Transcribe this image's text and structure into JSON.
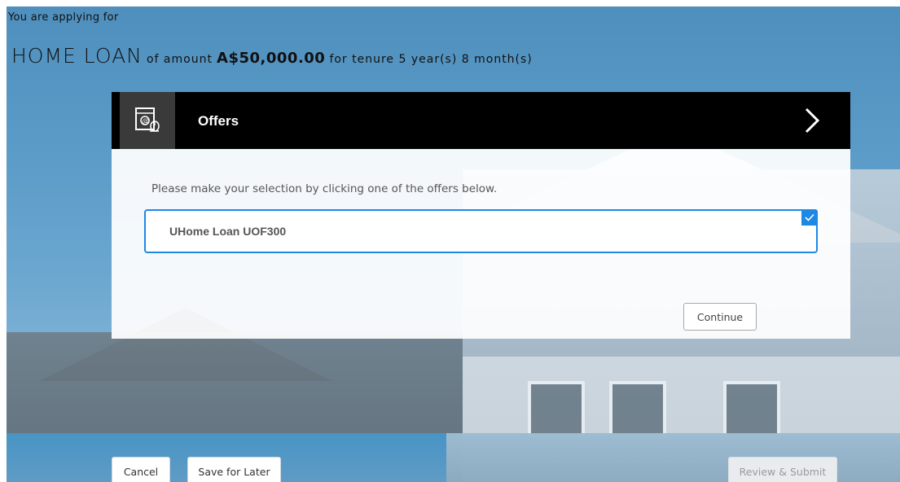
{
  "header": {
    "applying_text": "You are applying for",
    "product": "HOME LOAN",
    "of_amount_text": "of amount",
    "amount": "A$50,000.00",
    "tenure_text": "for tenure 5 year(s) 8 month(s)"
  },
  "offers_panel": {
    "title": "Offers",
    "icon": "offer-document-icon",
    "instruction": "Please make your selection by clicking one of the offers below.",
    "offers": [
      {
        "label": "UHome Loan UOF300",
        "selected": true
      }
    ],
    "continue_label": "Continue"
  },
  "footer": {
    "cancel_label": "Cancel",
    "save_label": "Save for Later",
    "review_label": "Review & Submit"
  },
  "colors": {
    "accent": "#1e88e5",
    "header_bg": "#000000"
  }
}
